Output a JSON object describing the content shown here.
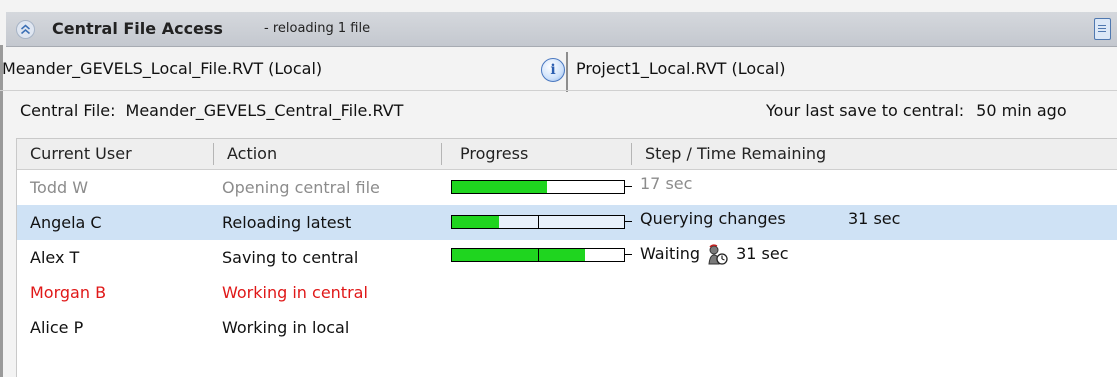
{
  "panel": {
    "title": "Central File Access",
    "subtitle": "- reloading 1 file"
  },
  "file_tabs": [
    {
      "label": "Meander_GEVELS_Local_File.RVT (Local)"
    },
    {
      "label": "Project1_Local.RVT (Local)"
    }
  ],
  "central_file": {
    "label": "Central File:",
    "name": "Meander_GEVELS_Central_File.RVT"
  },
  "last_save": {
    "label": "Your last save to central:",
    "value": "50 min ago"
  },
  "table": {
    "columns": [
      "Current User",
      "Action",
      "Progress",
      "Step / Time Remaining"
    ],
    "rows": [
      {
        "user": "Todd W",
        "action": "Opening central file",
        "progress": [
          0.55
        ],
        "step": "17 sec",
        "time": ""
      },
      {
        "user": "Angela C",
        "action": "Reloading latest",
        "progress": [
          0.55,
          0
        ],
        "step": "Querying changes",
        "time": "31 sec"
      },
      {
        "user": "Alex T",
        "action": "Saving to central",
        "progress": [
          1,
          0.55
        ],
        "step": "Waiting",
        "time": "31 sec"
      },
      {
        "user": "Morgan B",
        "action": "Working in central",
        "progress": null,
        "step": "",
        "time": ""
      },
      {
        "user": "Alice P",
        "action": "Working in local",
        "progress": null,
        "step": "",
        "time": ""
      }
    ]
  },
  "colors": {
    "progress_fill": "#1fd51f",
    "selected_row": "#cfe2f5",
    "inactive_text": "#8c8c8c",
    "central_text": "#e01818"
  },
  "icons": [
    "chevron-up-double-icon",
    "document-icon",
    "info-icon",
    "waiting-user-icon"
  ]
}
